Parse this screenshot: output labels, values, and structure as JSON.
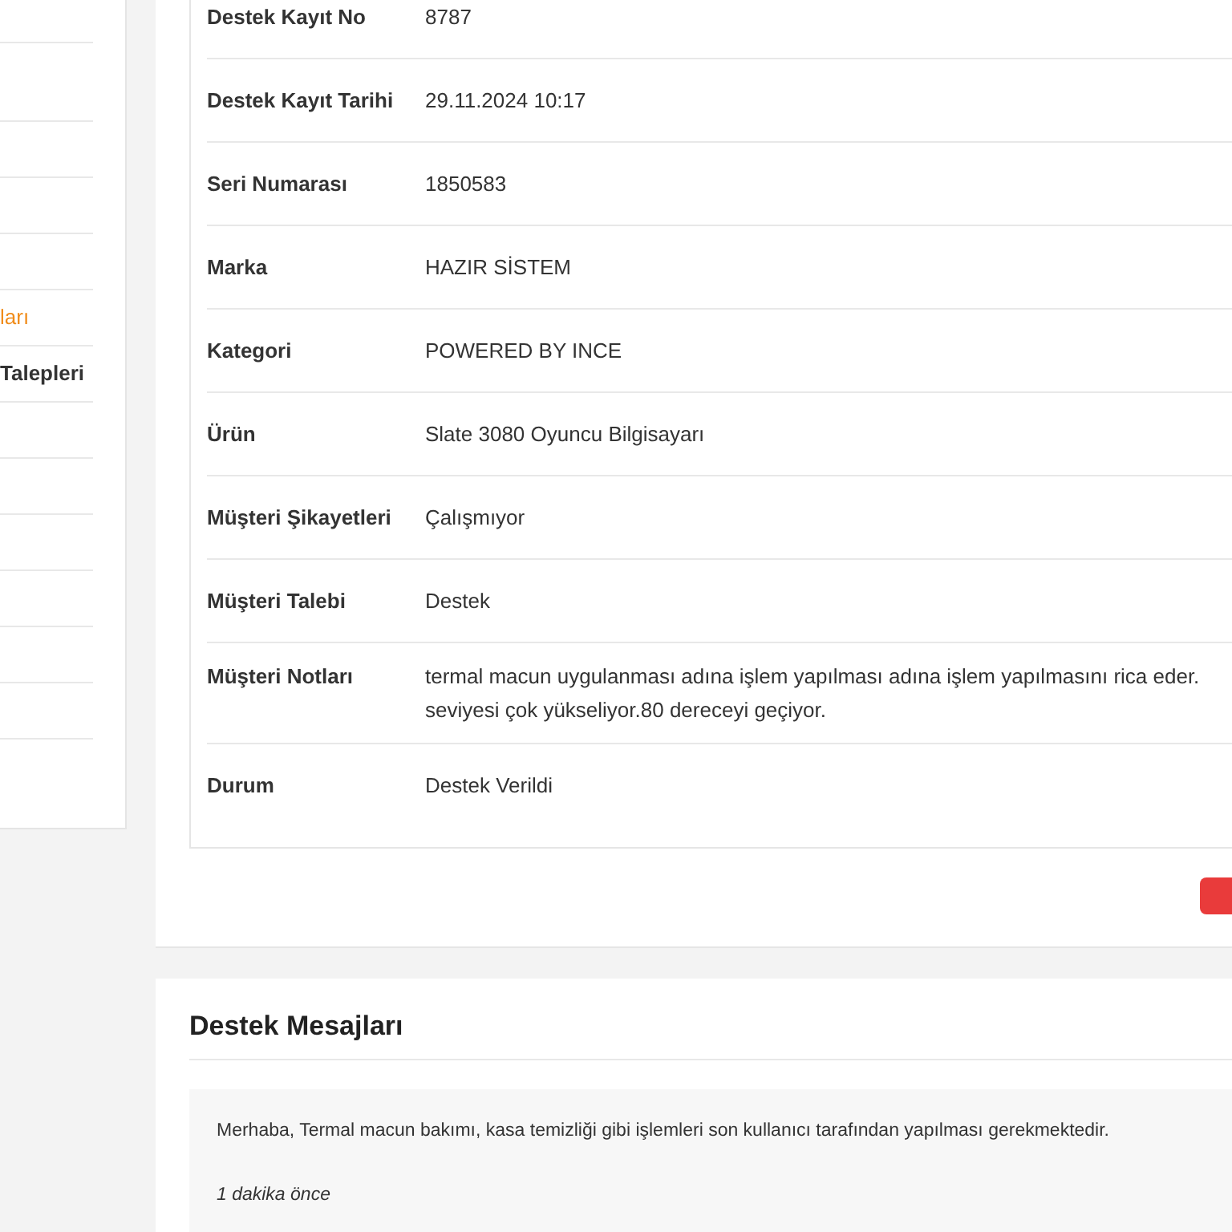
{
  "sidebar": {
    "items": [
      {
        "label": "ları",
        "selected": true
      },
      {
        "label": "Talepleri",
        "selected": false
      }
    ]
  },
  "details": {
    "rows": [
      {
        "label": "Destek Kayıt No",
        "value": [
          "8787"
        ]
      },
      {
        "label": "Destek Kayıt Tarihi",
        "value": [
          "29.11.2024 10:17"
        ]
      },
      {
        "label": "Seri Numarası",
        "value": [
          "1850583"
        ]
      },
      {
        "label": "Marka",
        "value": [
          "HAZIR SİSTEM"
        ]
      },
      {
        "label": "Kategori",
        "value": [
          "POWERED BY INCE"
        ]
      },
      {
        "label": "Ürün",
        "value": [
          "Slate 3080 Oyuncu Bilgisayarı"
        ]
      },
      {
        "label": "Müşteri Şikayetleri",
        "value": [
          "Çalışmıyor"
        ]
      },
      {
        "label": "Müşteri Talebi",
        "value": [
          "Destek"
        ]
      },
      {
        "label": "Müşteri Notları",
        "value": [
          "termal macun uygulanması adına işlem yapılması adına işlem yapılmasını rica eder.",
          "seviyesi çok yükseliyor.80 dereceyi geçiyor."
        ]
      },
      {
        "label": "Durum",
        "value": [
          "Destek Verildi"
        ]
      }
    ]
  },
  "messages": {
    "title": "Destek Mesajları",
    "items": [
      {
        "text": "Merhaba, Termal macun bakımı, kasa temizliği gibi işlemleri son kullanıcı tarafından yapılması gerekmektedir.",
        "time": "1 dakika önce"
      }
    ]
  }
}
